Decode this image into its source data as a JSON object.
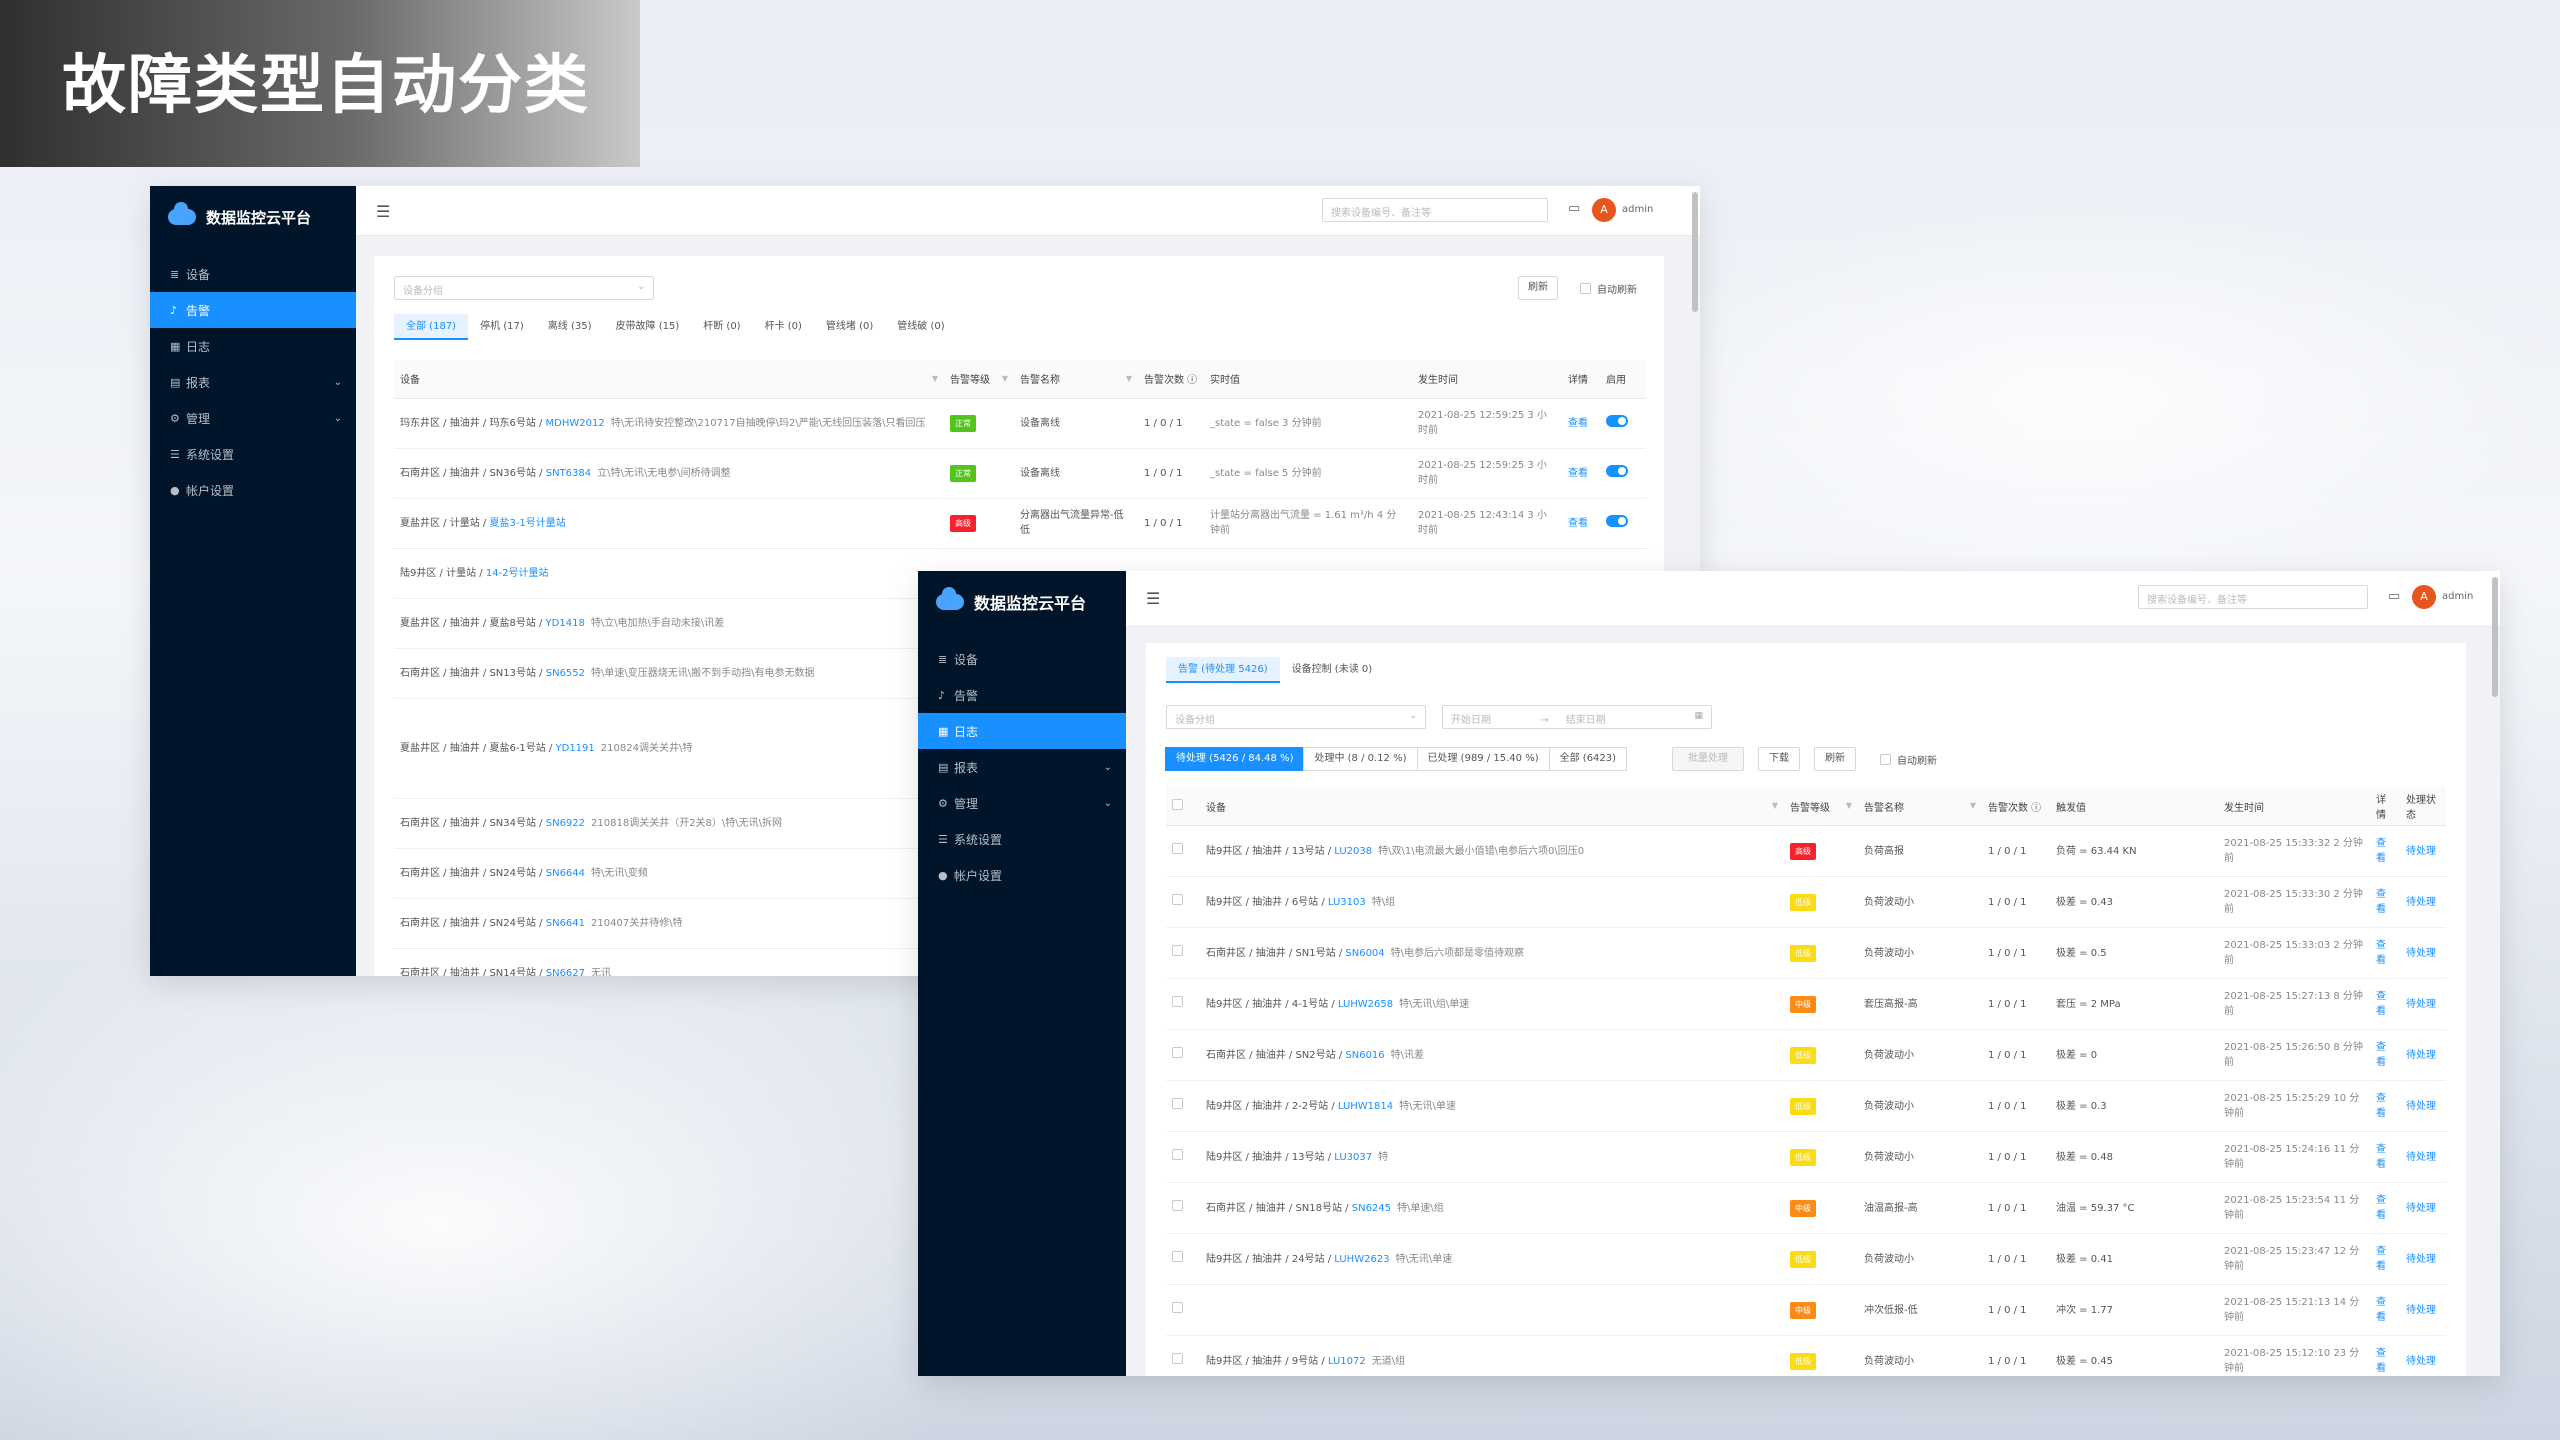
{
  "slide_title": "故障类型自动分类",
  "app": {
    "brand": "数据监控云平台",
    "nav": [
      {
        "label": "设备",
        "icon": "database-icon"
      },
      {
        "label": "告警",
        "icon": "bell-icon"
      },
      {
        "label": "日志",
        "icon": "calendar-icon"
      },
      {
        "label": "报表",
        "icon": "table-icon",
        "has_children": true
      },
      {
        "label": "管理",
        "icon": "gear-icon",
        "has_children": true
      },
      {
        "label": "系统设置",
        "icon": "sliders-icon"
      },
      {
        "label": "帐户设置",
        "icon": "user-icon"
      }
    ],
    "search_placeholder": "搜索设备编号、备注等",
    "avatar_letter": "A",
    "username": "admin"
  },
  "win1": {
    "active_nav": 1,
    "group_select_placeholder": "设备分组",
    "refresh_label": "刷新",
    "auto_refresh_label": "自动刷新",
    "tabs": [
      "全部 (187)",
      "停机 (17)",
      "离线 (35)",
      "皮带故障 (15)",
      "杆断 (0)",
      "杆卡 (0)",
      "管线堵 (0)",
      "管线破 (0)"
    ],
    "columns": [
      "设备",
      "告警等级",
      "告警名称",
      "告警次数 ⓘ",
      "实时值",
      "发生时间",
      "详情",
      "启用"
    ],
    "rows": [
      {
        "path": "玛东井区 / 抽油井 / 玛东6号站 / ",
        "code": "MDHW2012",
        "note": "特\\无讯待安控整改\\210717自抽晚停\\玛2\\严能\\无线回压装落\\只看回压",
        "level": "正常",
        "level_color": "#52c41a",
        "name": "设备离线",
        "count": "1 / 0 / 1",
        "value": "_state = false  3 分钟前",
        "time": "2021-08-25 12:59:25  3 小时前",
        "detail": "查看"
      },
      {
        "path": "石南井区 / 抽油井 / SN36号站 / ",
        "code": "SNT6384",
        "note": "立\\特\\无讯\\无电参\\间桥待调整",
        "level": "正常",
        "level_color": "#52c41a",
        "name": "设备离线",
        "count": "1 / 0 / 1",
        "value": "_state = false  5 分钟前",
        "time": "2021-08-25 12:59:25  3 小时前",
        "detail": "查看"
      },
      {
        "path": "夏盐井区 / 计量站 / ",
        "code": "夏盐3-1号计量站",
        "note": "",
        "level": "高级",
        "level_color": "#f5222d",
        "name": "分离器出气流量异常-低低",
        "count": "1 / 0 / 1",
        "value": "计量站分离器出气流量 = 1.61 m³/h  4 分钟前",
        "time": "2021-08-25 12:43:14  3 小时前",
        "detail": "查看"
      },
      {
        "path": "陆9井区 / 计量站 / ",
        "code": "14-2号计量站",
        "note": ""
      },
      {
        "path": "夏盐井区 / 抽油井 / 夏盐8号站 / ",
        "code": "YD1418",
        "note": "特\\立\\电加热\\手自动未接\\讯差"
      },
      {
        "path": "石南井区 / 抽油井 / SN13号站 / ",
        "code": "SN6552",
        "note": "特\\单速\\变压器烧无讯\\搬不到手动挡\\有电参无数据"
      },
      {
        "path": "夏盐井区 / 抽油井 / 夏盐6-1号站 / ",
        "code": "YD1191",
        "note": "210824调关关井\\特",
        "tall": true
      },
      {
        "path": "石南井区 / 抽油井 / SN34号站 / ",
        "code": "SN6922",
        "note": "210818调关关井（开2关8）\\特\\无讯\\拆网"
      },
      {
        "path": "石南井区 / 抽油井 / SN24号站 / ",
        "code": "SN6644",
        "note": "特\\无讯\\变频"
      },
      {
        "path": "石南井区 / 抽油井 / SN24号站 / ",
        "code": "SN6641",
        "note": "210407关井待修\\特"
      },
      {
        "path": "石南井区 / 抽油井 / SN14号站 / ",
        "code": "SN6627",
        "note": "无讯"
      }
    ]
  },
  "win2": {
    "active_nav": 2,
    "tabs": [
      "告警 (待处理 5426)",
      "设备控制 (未读 0)"
    ],
    "group_select_placeholder": "设备分组",
    "date_start_placeholder": "开始日期",
    "date_end_placeholder": "结束日期",
    "segments": [
      "待处理 (5426 / 84.48 %)",
      "处理中 (8 / 0.12 %)",
      "已处理 (989 / 15.40 %)",
      "全部 (6423)"
    ],
    "batch_label": "批量处理",
    "download_label": "下载",
    "refresh_label": "刷新",
    "auto_refresh_label": "自动刷新",
    "columns": [
      "设备",
      "告警等级",
      "告警名称",
      "告警次数 ⓘ",
      "触发值",
      "发生时间",
      "详情",
      "处理状态"
    ],
    "rows": [
      {
        "path": "陆9井区 / 抽油井 / 13号站 / ",
        "code": "LU2038",
        "note": "特\\双\\1\\电流最大最小值错\\电参后六项0\\回压0",
        "level": "高级",
        "level_color": "#f5222d",
        "name": "负荷高报",
        "count": "1 / 0 / 1",
        "value": "负荷 = 63.44 KN",
        "time": "2021-08-25 15:33:32  2 分钟前",
        "detail": "查看",
        "status": "待处理"
      },
      {
        "path": "陆9井区 / 抽油井 / 6号站 / ",
        "code": "LU3103",
        "note": "特\\组",
        "level": "低级",
        "level_color": "#fadb14",
        "name": "负荷波动小",
        "count": "1 / 0 / 1",
        "value": "极差 = 0.43",
        "time": "2021-08-25 15:33:30  2 分钟前",
        "detail": "查看",
        "status": "待处理"
      },
      {
        "path": "石南井区 / 抽油井 / SN1号站 / ",
        "code": "SN6004",
        "note": "特\\电参后六项都是零值待观察",
        "level": "低级",
        "level_color": "#fadb14",
        "name": "负荷波动小",
        "count": "1 / 0 / 1",
        "value": "极差 = 0.5",
        "time": "2021-08-25 15:33:03  2 分钟前",
        "detail": "查看",
        "status": "待处理"
      },
      {
        "path": "陆9井区 / 抽油井 / 4-1号站 / ",
        "code": "LUHW2658",
        "note": "特\\无讯\\组\\单速",
        "level": "中级",
        "level_color": "#fa8c16",
        "name": "套压高报-高",
        "count": "1 / 0 / 1",
        "value": "套压 = 2 MPa",
        "time": "2021-08-25 15:27:13  8 分钟前",
        "detail": "查看",
        "status": "待处理"
      },
      {
        "path": "石南井区 / 抽油井 / SN2号站 / ",
        "code": "SN6016",
        "note": "特\\讯差",
        "level": "低级",
        "level_color": "#fadb14",
        "name": "负荷波动小",
        "count": "1 / 0 / 1",
        "value": "极差 = 0",
        "time": "2021-08-25 15:26:50  8 分钟前",
        "detail": "查看",
        "status": "待处理"
      },
      {
        "path": "陆9井区 / 抽油井 / 2-2号站 / ",
        "code": "LUHW1814",
        "note": "特\\无讯\\单速",
        "level": "低级",
        "level_color": "#fadb14",
        "name": "负荷波动小",
        "count": "1 / 0 / 1",
        "value": "极差 = 0.3",
        "time": "2021-08-25 15:25:29  10 分钟前",
        "detail": "查看",
        "status": "待处理"
      },
      {
        "path": "陆9井区 / 抽油井 / 13号站 / ",
        "code": "LU3037",
        "note": "特",
        "level": "低级",
        "level_color": "#fadb14",
        "name": "负荷波动小",
        "count": "1 / 0 / 1",
        "value": "极差 = 0.48",
        "time": "2021-08-25 15:24:16  11 分钟前",
        "detail": "查看",
        "status": "待处理"
      },
      {
        "path": "石南井区 / 抽油井 / SN18号站 / ",
        "code": "SN6245",
        "note": "特\\单速\\组",
        "level": "中级",
        "level_color": "#fa8c16",
        "name": "油温高报-高",
        "count": "1 / 0 / 1",
        "value": "油温 = 59.37 °C",
        "time": "2021-08-25 15:23:54  11 分钟前",
        "detail": "查看",
        "status": "待处理"
      },
      {
        "path": "陆9井区 / 抽油井 / 24号站 / ",
        "code": "LUHW2623",
        "note": "特\\无讯\\单速",
        "level": "低级",
        "level_color": "#fadb14",
        "name": "负荷波动小",
        "count": "1 / 0 / 1",
        "value": "极差 = 0.41",
        "time": "2021-08-25 15:23:47  12 分钟前",
        "detail": "查看",
        "status": "待处理"
      },
      {
        "path": "",
        "code": "",
        "note": "",
        "level": "中级",
        "level_color": "#fa8c16",
        "name": "冲次低报-低",
        "count": "1 / 0 / 1",
        "value": "冲次 = 1.77",
        "time": "2021-08-25 15:21:13  14 分钟前",
        "detail": "查看",
        "status": "待处理"
      },
      {
        "path": "陆9井区 / 抽油井 / 9号站 / ",
        "code": "LU1072",
        "note": "无道\\组",
        "level": "低级",
        "level_color": "#fadb14",
        "name": "负荷波动小",
        "count": "1 / 0 / 1",
        "value": "极差 = 0.45",
        "time": "2021-08-25 15:12:10  23 分钟前",
        "detail": "查看",
        "status": "待处理"
      }
    ]
  }
}
